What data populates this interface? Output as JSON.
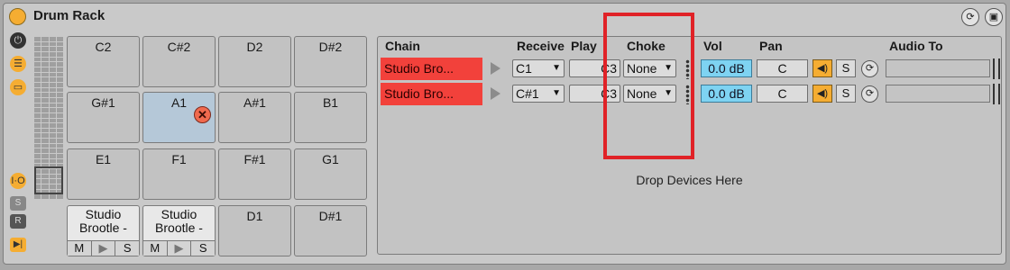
{
  "device": {
    "title": "Drum Rack"
  },
  "left_icons": [
    "power-icon",
    "list-icon",
    "macro-icon",
    "io-icon",
    "s-icon",
    "r-icon",
    "chain-icon"
  ],
  "pads": [
    {
      "note": "C2"
    },
    {
      "note": "C#2"
    },
    {
      "note": "D2"
    },
    {
      "note": "D#2"
    },
    {
      "note": "G#1"
    },
    {
      "note": "A1"
    },
    {
      "note": "A#1"
    },
    {
      "note": "B1"
    },
    {
      "note": "E1"
    },
    {
      "note": "F1"
    },
    {
      "note": "F#1"
    },
    {
      "note": "G1"
    },
    {
      "note": "Studio Brootle -"
    },
    {
      "note": "Studio Brootle -"
    },
    {
      "note": "D1"
    },
    {
      "note": "D#1"
    }
  ],
  "pad_controls": {
    "mute": "M",
    "play": "▶",
    "solo": "S"
  },
  "chain_headers": {
    "chain": "Chain",
    "receive": "Receive",
    "play": "Play",
    "choke": "Choke",
    "vol": "Vol",
    "pan": "Pan",
    "audio_to": "Audio To"
  },
  "chains": [
    {
      "name": "Studio Bro...",
      "receive": "C1",
      "play": "C3",
      "choke": "None",
      "vol": "0.0 dB",
      "pan": "C",
      "solo": "S"
    },
    {
      "name": "Studio Bro...",
      "receive": "C#1",
      "play": "C3",
      "choke": "None",
      "vol": "0.0 dB",
      "pan": "C",
      "solo": "S"
    }
  ],
  "drop_text": "Drop Devices Here",
  "colors": {
    "accent": "#f5ad32",
    "chain_red": "#f2413b",
    "vol_blue": "#7ed3f2",
    "selected_pad": "#b5c8d8",
    "annotation_red": "#e02227"
  }
}
